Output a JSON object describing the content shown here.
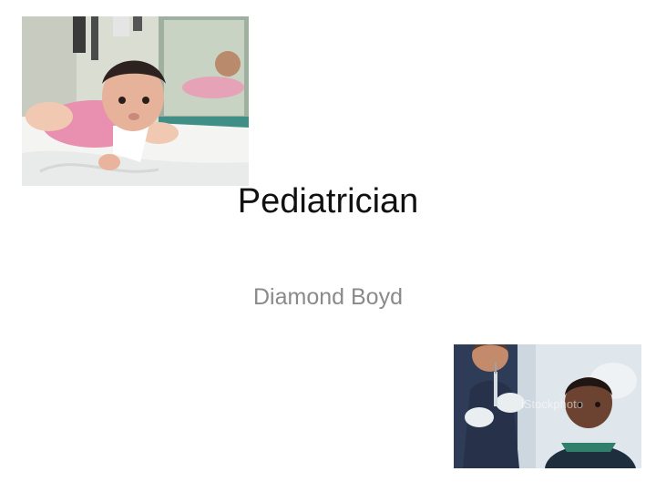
{
  "slide": {
    "title": "Pediatrician",
    "subtitle": "Diamond Boyd"
  },
  "images": {
    "top_left": {
      "icon": "baby-photo-icon"
    },
    "bottom_right": {
      "icon": "child-vaccination-photo-icon",
      "watermark": "iStockphoto"
    }
  },
  "colors": {
    "background": "#ffffff",
    "title": "#111111",
    "subtitle": "#8a8a8a"
  }
}
